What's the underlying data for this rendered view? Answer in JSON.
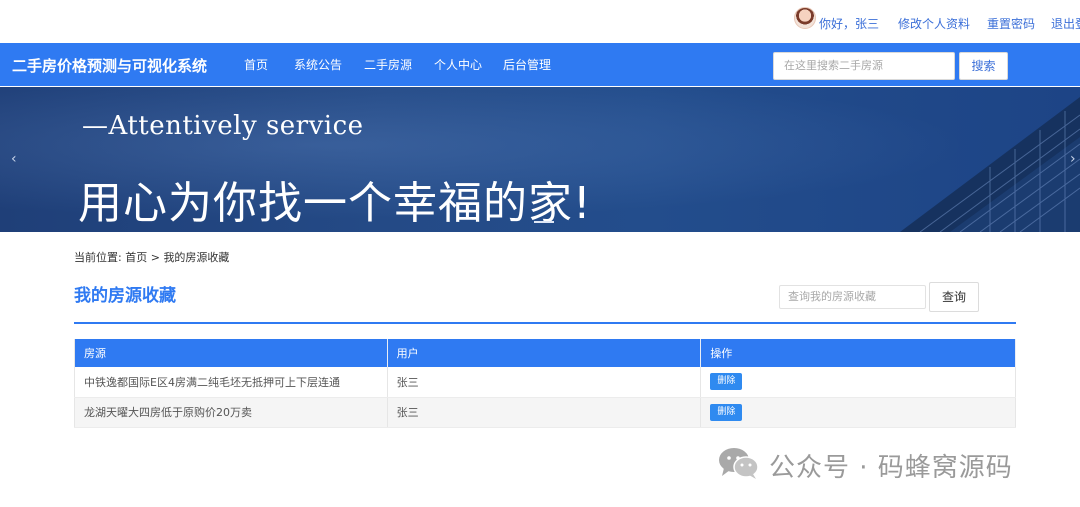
{
  "topbar": {
    "greeting": "你好，张三",
    "edit_profile": "修改个人资料",
    "reset_password": "重置密码",
    "logout": "退出登"
  },
  "nav": {
    "brand": "二手房价格预测与可视化系统",
    "items": [
      {
        "label": "首页"
      },
      {
        "label": "系统公告"
      },
      {
        "label": "二手房源"
      },
      {
        "label": "个人中心"
      },
      {
        "label": "后台管理"
      }
    ],
    "search_placeholder": "在这里搜索二手房源",
    "search_button": "搜索"
  },
  "banner": {
    "subtitle": "—Attentively  service",
    "title": "用心为你找一个幸福的家!",
    "prev_arrow": "‹",
    "next_arrow": "›"
  },
  "breadcrumb": {
    "prefix": "当前位置:",
    "home": "首页",
    "separator": ">",
    "current": "我的房源收藏"
  },
  "main": {
    "title": "我的房源收藏",
    "search_placeholder": "查询我的房源收藏",
    "query_button": "查询",
    "columns": [
      "房源",
      "用户",
      "操作"
    ],
    "rows": [
      {
        "house": "中铁逸都国际E区4房满二纯毛坯无抵押可上下层连通",
        "user": "张三",
        "action": "删除"
      },
      {
        "house": "龙湖天曜大四房低于原购价20万卖",
        "user": "张三",
        "action": "删除"
      }
    ]
  },
  "watermark": {
    "text": "公众号 · 码蜂窝源码",
    "icon": "wechat-icon"
  },
  "colors": {
    "primary": "#2f7af2",
    "link": "#3b6fd8",
    "banner": "#234d8c"
  }
}
